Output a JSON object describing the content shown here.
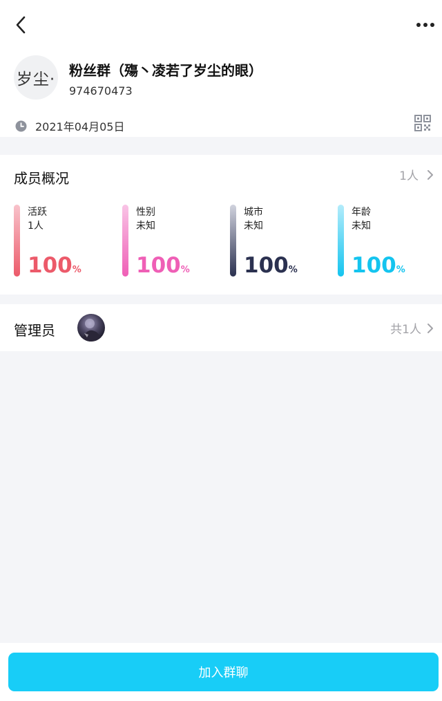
{
  "nav": {
    "back_icon": "chevron-left-icon",
    "more_icon": "more-horizontal-icon"
  },
  "group": {
    "avatar_text": "岁尘·",
    "name": "粉丝群（殤丶凌若了岁尘的眼）",
    "id": "974670473",
    "date": "2021年04月05日",
    "date_icon": "clock-icon",
    "qr_icon": "qr-code-icon"
  },
  "members": {
    "title": "成员概况",
    "count": "1人",
    "stats": [
      {
        "label": "活跃",
        "sub": "1人",
        "value": "100",
        "unit": "%",
        "color": "#ec5a6a",
        "bar_from": "#f8c3cb",
        "bar_to": "#ec5a6a"
      },
      {
        "label": "性别",
        "sub": "未知",
        "value": "100",
        "unit": "%",
        "color": "#ef5fb6",
        "bar_from": "#f9c4e6",
        "bar_to": "#ef5fb6"
      },
      {
        "label": "城市",
        "sub": "未知",
        "value": "100",
        "unit": "%",
        "color": "#2b3150",
        "bar_from": "#d1d3de",
        "bar_to": "#2b3150"
      },
      {
        "label": "年龄",
        "sub": "未知",
        "value": "100",
        "unit": "%",
        "color": "#14c4ef",
        "bar_from": "#b4ecfb",
        "bar_to": "#14c4ef"
      }
    ]
  },
  "admin": {
    "title": "管理员",
    "count": "共1人"
  },
  "footer": {
    "join_label": "加入群聊"
  },
  "colors": {
    "accent": "#18cdf7",
    "muted": "#a3a3a8",
    "background": "#f4f5f8"
  }
}
